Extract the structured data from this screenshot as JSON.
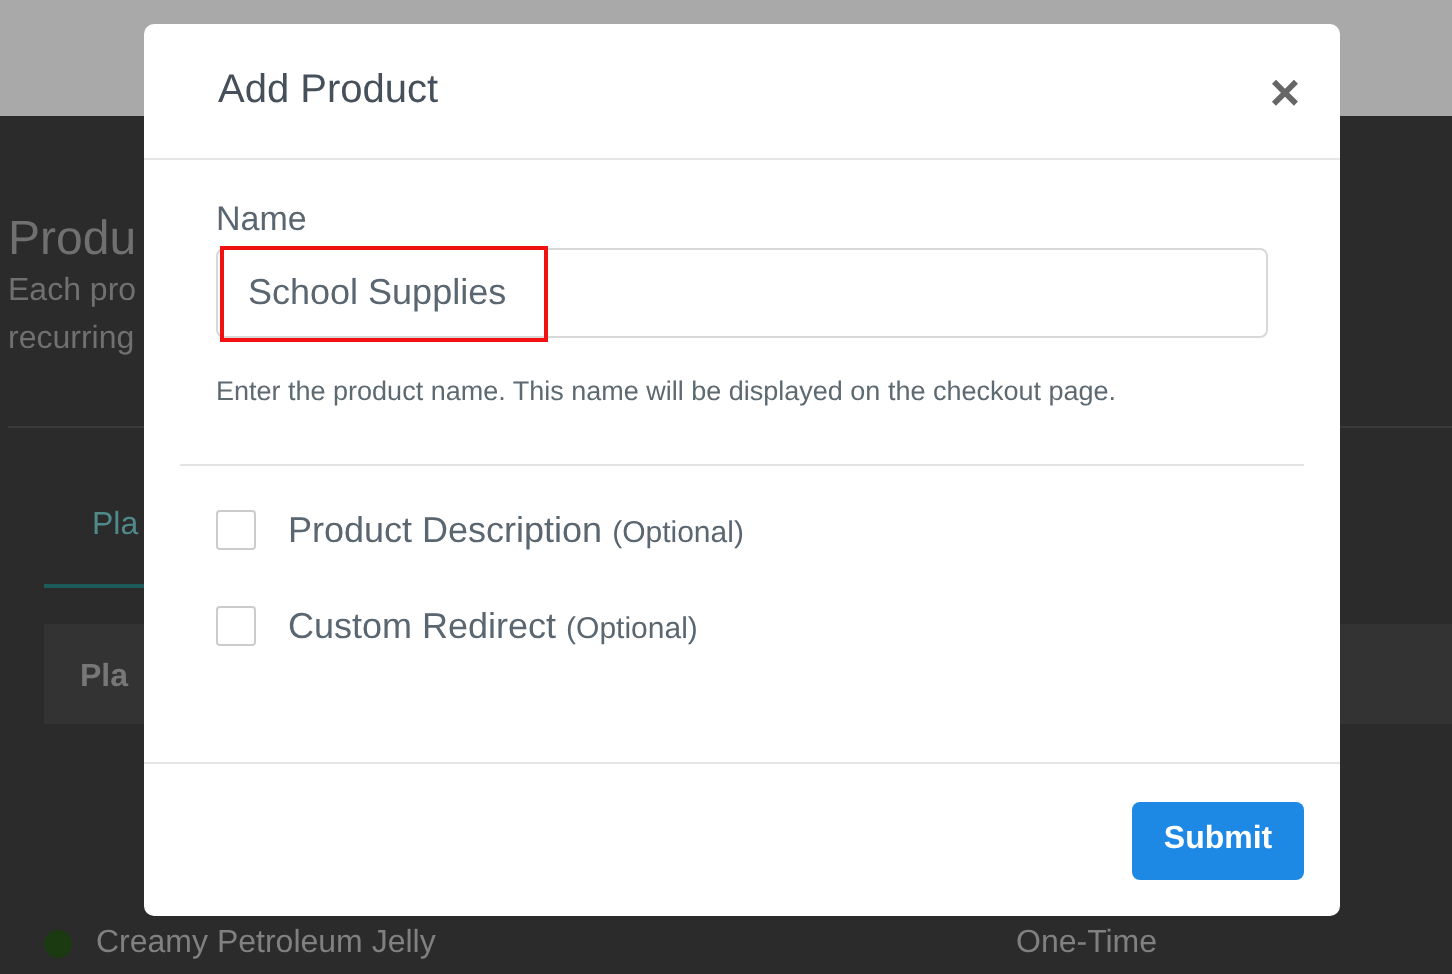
{
  "background": {
    "title": "Produ",
    "description_lines": [
      "Each pro",
      "recurring"
    ],
    "tab": {
      "label": "Pla",
      "selected": true
    },
    "table_header": "Pla",
    "row": {
      "name": "Creamy Petroleum Jelly",
      "type": "One-Time",
      "color": "#1b3a12"
    }
  },
  "dialog": {
    "title": "Add Product",
    "close": "×",
    "name_field": {
      "label": "Name",
      "value": "School Supplies",
      "highlighted": true
    },
    "help": "Enter the product name. This name will be displayed on the checkout page.",
    "options": [
      {
        "label": "Product Description",
        "note": "(Optional)",
        "checked": false
      },
      {
        "label": "Custom Redirect",
        "note": "(Optional)",
        "checked": false
      }
    ],
    "submit": "Submit"
  }
}
